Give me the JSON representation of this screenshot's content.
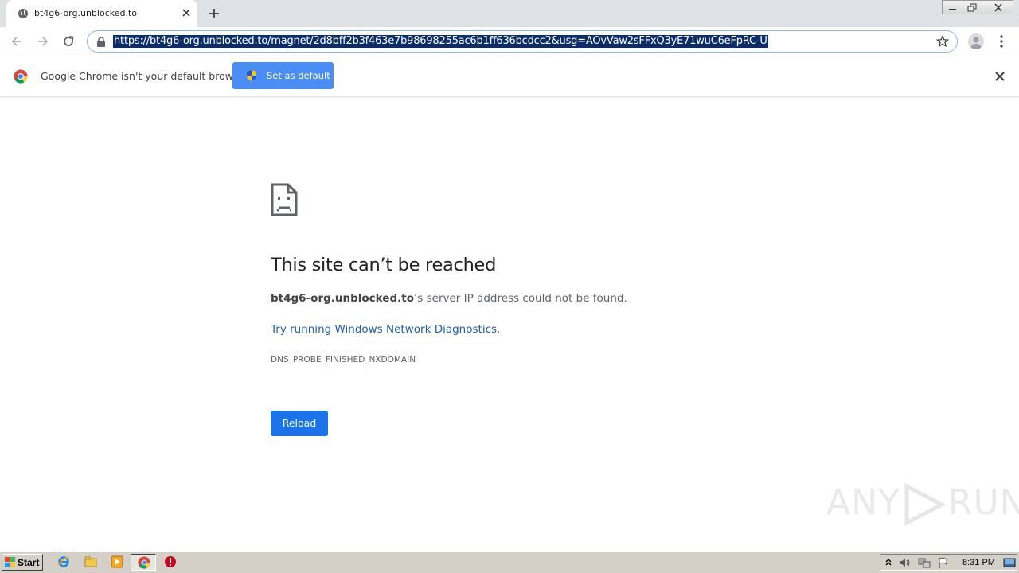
{
  "tab": {
    "title": "bt4g6-org.unblocked.to"
  },
  "toolbar": {
    "url": "https://bt4g6-org.unblocked.to/magnet/2d8bff2b3f463e7b98698255ac6b1ff636bcdcc2&usg=AOvVaw2sFFxQ3yE71wuC6eFpRC-U"
  },
  "infobar": {
    "message": "Google Chrome isn't your default browser",
    "button_label": "Set as default"
  },
  "error": {
    "title": "This site can’t be reached",
    "host": "bt4g6-org.unblocked.to",
    "message_suffix": "’s server IP address could not be found.",
    "diagnostics_link": "Try running Windows Network Diagnostics.",
    "code": "DNS_PROBE_FINISHED_NXDOMAIN",
    "reload_label": "Reload"
  },
  "watermark": {
    "left": "ANY",
    "right": "RUN"
  },
  "taskbar": {
    "start_label": "Start",
    "clock": "8:31 PM"
  },
  "colors": {
    "accent": "#1a73e8",
    "link": "#1a5fb4",
    "infobar_button": "#4a8ef5",
    "url_selection": "#0b2d6b"
  },
  "icons": {
    "tab_favicon": "globe-icon",
    "error": "sad-page-icon",
    "lock": "lock-icon",
    "bookmark": "star-icon"
  }
}
